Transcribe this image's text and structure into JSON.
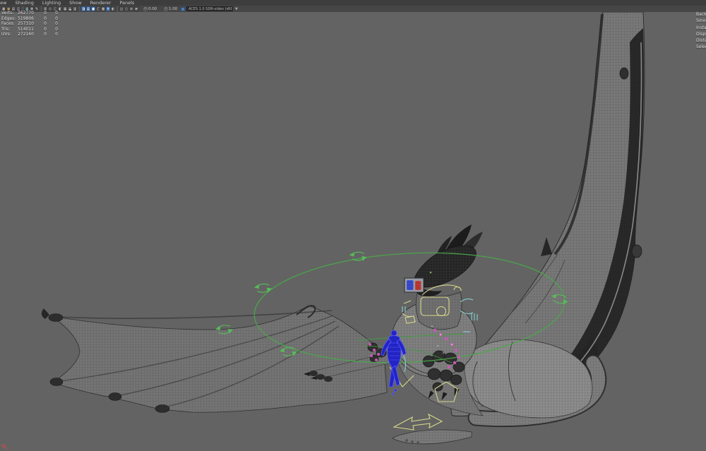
{
  "menu_bar": {
    "items": [
      "View",
      "Shading",
      "Lighting",
      "Show",
      "Renderer",
      "Panels"
    ]
  },
  "toolbar": {
    "icons": [
      {
        "name": "select-camera",
        "glyph": "▣"
      },
      {
        "name": "lock-camera",
        "glyph": "◉",
        "color": "#d8a060"
      },
      {
        "name": "camera-attributes",
        "glyph": "▤"
      },
      {
        "name": "bookmarks",
        "glyph": "◫"
      },
      {
        "sep": true
      },
      {
        "name": "image-plane",
        "glyph": "▦",
        "color": "#7fb8c8"
      },
      {
        "name": "two-d-pan-zoom",
        "glyph": "✥"
      },
      {
        "name": "grease-pencil",
        "glyph": "✎"
      },
      {
        "sep": true
      },
      {
        "name": "grid",
        "glyph": "⊞"
      },
      {
        "name": "film-gate",
        "glyph": "▭"
      },
      {
        "name": "resolution-gate",
        "glyph": "▢"
      },
      {
        "name": "gate-mask",
        "glyph": "◧"
      },
      {
        "name": "field-chart",
        "glyph": "▦"
      },
      {
        "name": "safe-action",
        "glyph": "⬓"
      },
      {
        "name": "safe-title",
        "glyph": "▥"
      },
      {
        "sep": true
      },
      {
        "name": "heads-up-display",
        "glyph": "◨",
        "active": true
      },
      {
        "name": "object-details",
        "glyph": "▤",
        "active": true
      },
      {
        "name": "shaded-mode",
        "glyph": "●",
        "active": true
      },
      {
        "name": "wireframe-mode",
        "glyph": "◯"
      },
      {
        "name": "textured-mode",
        "glyph": "▩"
      },
      {
        "name": "use-all-lights",
        "glyph": "☀",
        "active": true
      },
      {
        "name": "shadows",
        "glyph": "◐"
      },
      {
        "sep": true
      },
      {
        "name": "xray",
        "glyph": "◻"
      },
      {
        "name": "screen-space-ao",
        "glyph": "◌"
      },
      {
        "name": "motion-blur",
        "glyph": "≋"
      },
      {
        "name": "anti-aliasing",
        "glyph": "▰"
      }
    ],
    "exposure_label": "0.00",
    "gamma_label": "1.00",
    "colorspace": "ACES 1.0 SDR-video (sRGB)"
  },
  "hud": {
    "poly_count": {
      "rows": [
        {
          "label": "Verts:",
          "total": "262770",
          "sel_obj": "0",
          "sel_comp": "0"
        },
        {
          "label": "Edges:",
          "total": "519806",
          "sel_obj": "0",
          "sel_comp": "0"
        },
        {
          "label": "Faces:",
          "total": "257310",
          "sel_obj": "0",
          "sel_comp": "0"
        },
        {
          "label": "Tris:",
          "total": "514011",
          "sel_obj": "0",
          "sel_comp": "0"
        },
        {
          "label": "UVs:",
          "total": "272160",
          "sel_obj": "0",
          "sel_comp": "0"
        }
      ]
    },
    "object_details": {
      "labels": [
        "Backfaces",
        "Smoothness",
        "Instance",
        "Display Layer",
        "Distance From Camera",
        "Selected Objects"
      ]
    }
  },
  "viewport": {
    "scene": "wireframe dragon model with animation rig controls and small blue humanoid for scale",
    "colors": {
      "background": "#636363",
      "mesh": "#7a7a7a",
      "rig_green": "#4aa84a",
      "rig_yellow": "#d8d88a",
      "rig_cyan": "#8adada",
      "selection_blue": "#2b2bd0",
      "joint_magenta": "#c75ab5",
      "widget_red": "#c23b35",
      "widget_blue": "#3b4ed0"
    }
  }
}
